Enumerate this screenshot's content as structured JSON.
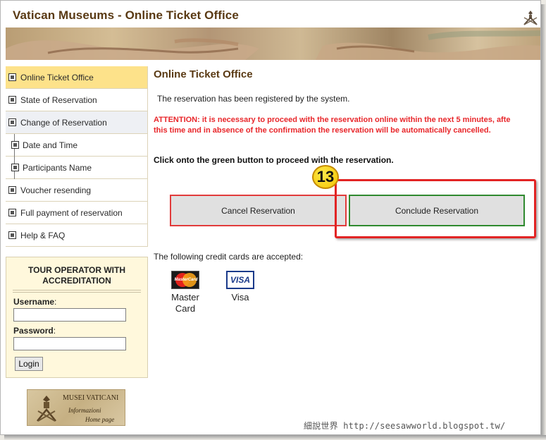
{
  "header": {
    "site_title": "Vatican Museums - Online Ticket Office"
  },
  "sidebar": {
    "items": [
      {
        "label": "Online Ticket Office",
        "state": "active"
      },
      {
        "label": "State of Reservation",
        "state": "normal"
      },
      {
        "label": "Change of Reservation",
        "state": "hover"
      },
      {
        "label": "Date and Time",
        "state": "sub"
      },
      {
        "label": "Participants Name",
        "state": "sub"
      },
      {
        "label": "Voucher resending",
        "state": "normal"
      },
      {
        "label": "Full payment of reservation",
        "state": "normal"
      },
      {
        "label": "Help & FAQ",
        "state": "normal"
      }
    ],
    "login": {
      "title": "TOUR OPERATOR WITH ACCREDITATION",
      "username_label": "Username",
      "password_label": "Password",
      "colon": ":",
      "username_value": "",
      "password_value": "",
      "button_label": "Login"
    },
    "logo": {
      "name": "MUSEI VATICANI",
      "line1": "Informazioni",
      "line2": "Home page"
    }
  },
  "main": {
    "title": "Online Ticket Office",
    "confirmation": "The reservation has been registered by the system.",
    "attention_line1": "ATTENTION: it is necessary to proceed with the reservation online within the next 5 minutes, afte",
    "attention_line2": "this time and in absence of the confirmation the reservation will be automatically cancelled.",
    "instruction": "Click onto the green button to proceed with the reservation.",
    "cancel_label": "Cancel Reservation",
    "conclude_label": "Conclude Reservation",
    "cards_text": "The following credit cards are accepted:",
    "cards": [
      {
        "logo_text": "MasterCard",
        "label": "Master Card"
      },
      {
        "logo_text": "VISA",
        "label": "Visa"
      }
    ]
  },
  "annotation": {
    "step_number": "13",
    "highlight_color": "#e22424",
    "badge_color": "#f2c300"
  },
  "watermark": "細說世界 http://seesawworld.blogspot.tw/",
  "colors": {
    "title_brown": "#5a3a14",
    "attention_red": "#e8262a",
    "active_nav": "#fde28a",
    "cancel_border": "#e23b3b",
    "conclude_border": "#2f8a2f"
  }
}
